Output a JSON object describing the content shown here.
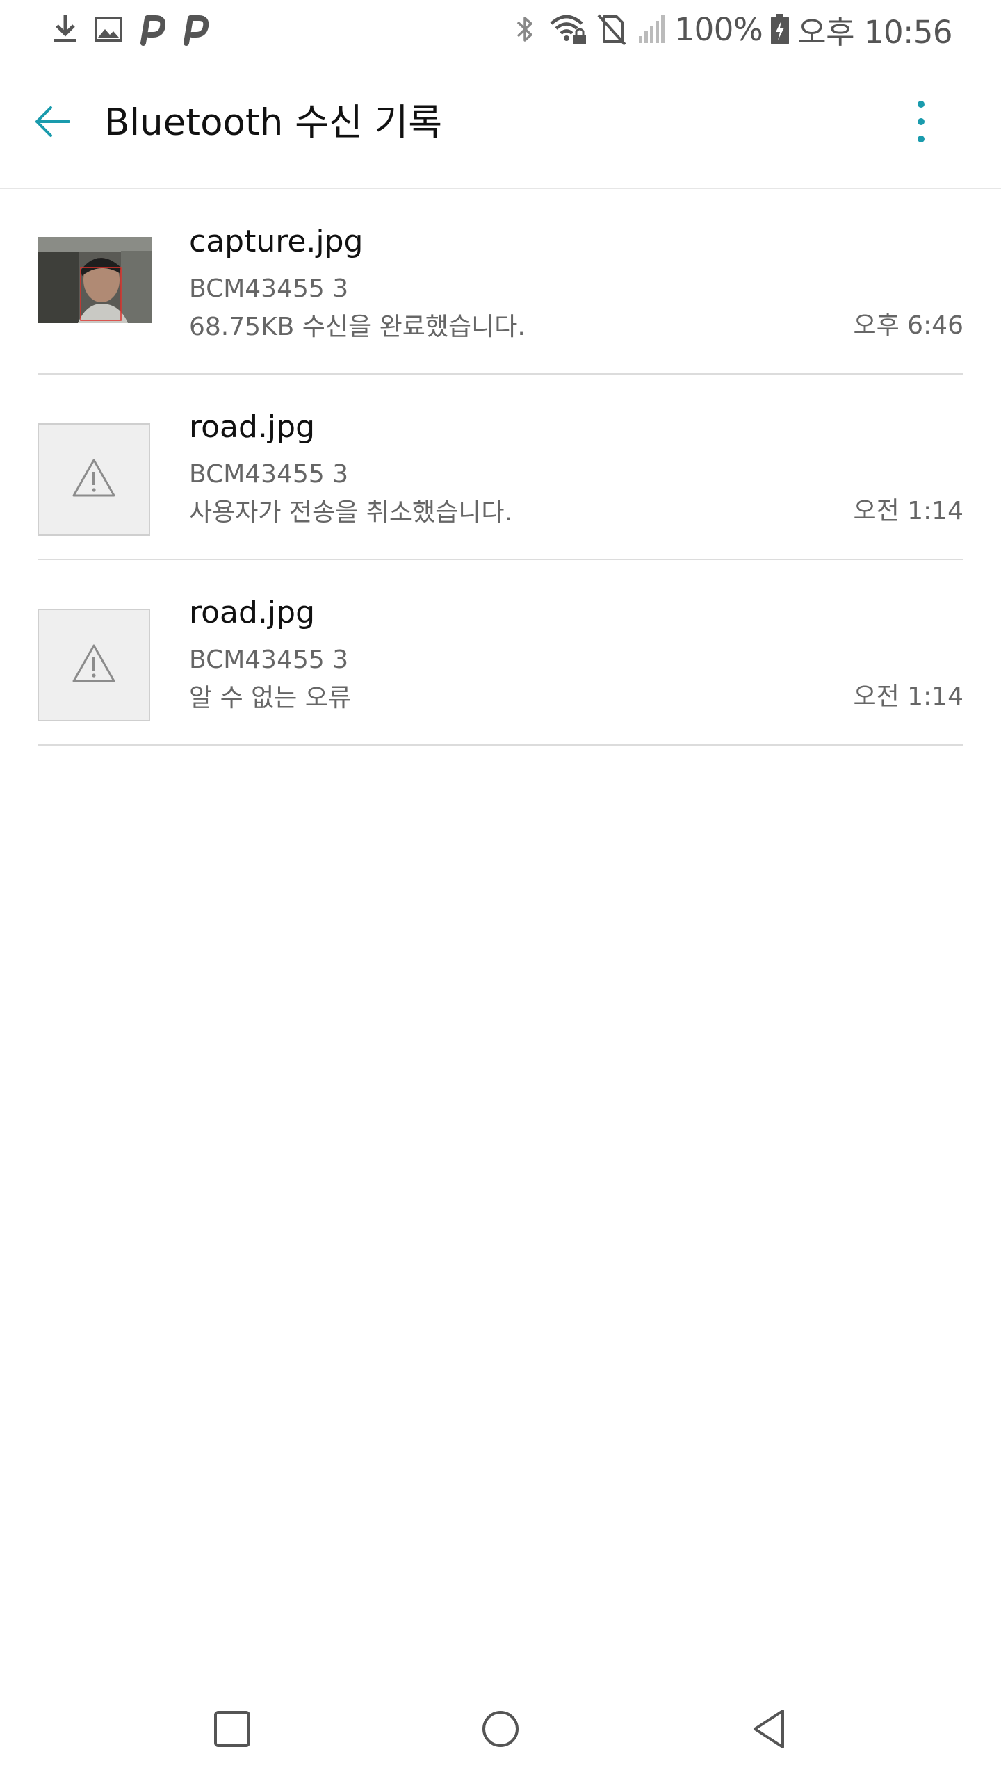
{
  "status_bar": {
    "left_icons": [
      "download-icon",
      "image-icon",
      "p-app-icon",
      "p-app-icon"
    ],
    "right_icons": [
      "bluetooth-icon",
      "wifi-lock-icon",
      "no-sim-icon",
      "signal-icon"
    ],
    "battery": "100%",
    "time": "오후 10:56"
  },
  "app_bar": {
    "title": "Bluetooth 수신 기록",
    "back_icon": "back-arrow-icon",
    "menu_icon": "more-vert-icon"
  },
  "colors": {
    "accent": "#1a9bad",
    "text_primary": "#111111",
    "text_secondary": "#666666",
    "divider": "#dcdcdc",
    "thumb_bg": "#efefef"
  },
  "items": [
    {
      "name": "capture.jpg",
      "device": "BCM43455 3",
      "status": "68.75KB 수신을 완료했습니다.",
      "time": "오후 6:46",
      "thumbnail": "photo"
    },
    {
      "name": "road.jpg",
      "device": "BCM43455 3",
      "status": "사용자가 전송을 취소했습니다.",
      "time": "오전 1:14",
      "thumbnail": "warning-icon"
    },
    {
      "name": "road.jpg",
      "device": "BCM43455 3",
      "status": "알 수 없는 오류",
      "time": "오전 1:14",
      "thumbnail": "warning-icon"
    }
  ],
  "nav_bar": {
    "buttons": [
      "recent-apps-icon",
      "home-icon",
      "back-icon"
    ]
  }
}
